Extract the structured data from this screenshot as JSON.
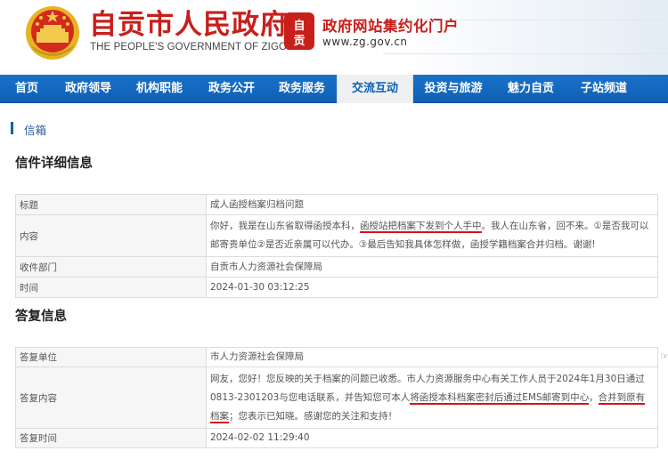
{
  "header": {
    "site_title": "自贡市人民政府",
    "site_subtitle": "THE PEOPLE'S GOVERNMENT OF ZIGONG",
    "seal_text": "自贡",
    "portal_name": "政府网站集约化门户",
    "portal_url": "www.zg.gov.cn",
    "brand_color": "#c81f1b"
  },
  "nav": {
    "items": [
      {
        "label": "首页"
      },
      {
        "label": "政府领导"
      },
      {
        "label": "机构职能"
      },
      {
        "label": "政务公开"
      },
      {
        "label": "政务服务"
      },
      {
        "label": "交流互动",
        "active": true
      },
      {
        "label": "投资与旅游"
      },
      {
        "label": "魅力自贡"
      },
      {
        "label": "子站频道"
      }
    ],
    "color": "#0e5fb3"
  },
  "breadcrumb": {
    "label": "信箱"
  },
  "letter": {
    "section_title": "信件详细信息",
    "rows": {
      "title_label": "标题",
      "title_value": "成人函授档案归档问题",
      "content_label": "内容",
      "content_p1": "你好，我是在山东省取得函授本科，",
      "content_p2": "函授站把档案下发到个人手中",
      "content_p3": "。我人在山东省，回不来。①是否我可以邮寄贵单位②是否近亲属可以代办。③最后告知我具体怎样做，函授学籍档案合并归档。谢谢!",
      "dept_label": "收件部门",
      "dept_value": "自贡市人力资源社会保障局",
      "time_label": "时间",
      "time_value": "2024-01-30 03:12:25"
    }
  },
  "reply": {
    "section_title": "答复信息",
    "rows": {
      "unit_label": "答复单位",
      "unit_value": "市人力资源社会保障局",
      "content_label": "答复内容",
      "content_p1": "网友，您好！您反映的关于档案的问题已收悉。市人力资源服务中心有关工作人员于2024年1月30日通过0813-2301203与您电话联系，并告知您可本人",
      "content_p2": "将函授本科档案密封后通过EMS邮寄到中心",
      "content_p3": "，",
      "content_p4": "合并到原有档案",
      "content_p5": "；您表示已知晓。感谢您的关注和支持！",
      "time_label": "答复时间",
      "time_value": "2024-02-02 11:29:40"
    }
  }
}
